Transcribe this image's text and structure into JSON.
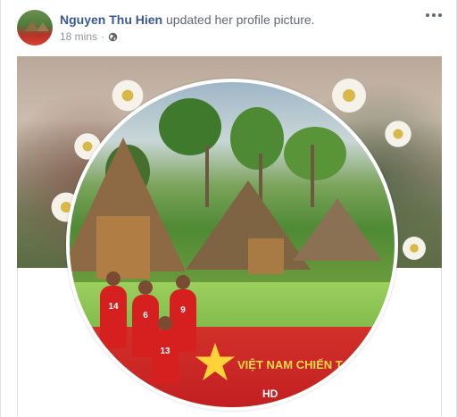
{
  "post": {
    "author": "Nguyen Thu Hien",
    "action": " updated her profile picture.",
    "time": "18 mins",
    "separator": "·",
    "privacy_icon": "globe-icon",
    "more_icon": "more-options-icon"
  },
  "profile_picture": {
    "banner_text": "VIỆT NAM CHIẾN T",
    "banner_logo": "HD",
    "player_numbers": [
      "14",
      "6",
      "9",
      "13"
    ]
  },
  "colors": {
    "author_link": "#385898",
    "meta_text": "#90949c",
    "banner_red": "#c31f22",
    "banner_text": "#ffd94a"
  }
}
